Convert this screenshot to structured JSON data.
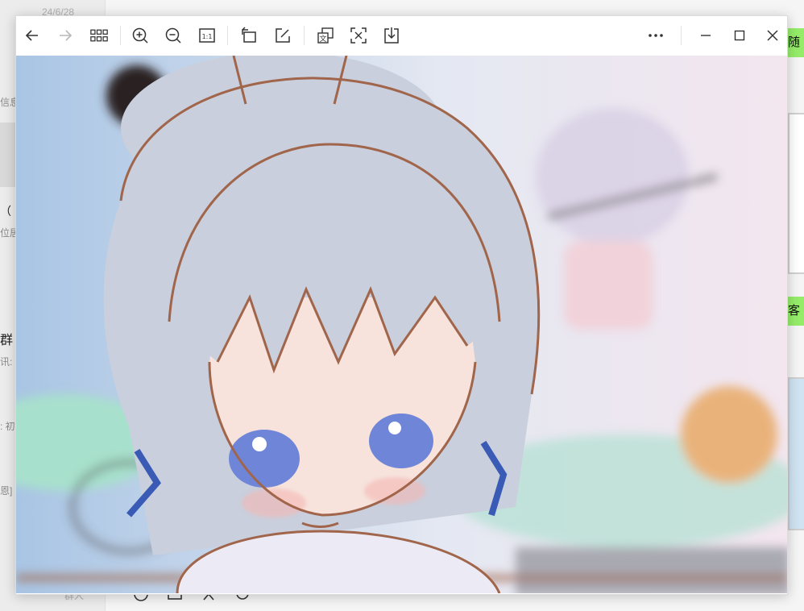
{
  "background_app": {
    "sidebar_date": "24/6/28",
    "fragments": [
      {
        "text": "信息",
        "small": true
      },
      {
        "text": "（",
        "small": false
      },
      {
        "text": "位居",
        "small": true
      },
      {
        "text": "群",
        "small": false
      },
      {
        "text": "讯:",
        "small": true
      },
      {
        "text": ": 初",
        "small": true
      },
      {
        "text": "恩]",
        "small": true
      },
      {
        "text": "群人",
        "small": true
      }
    ],
    "bubbles": [
      "随",
      "客串"
    ]
  },
  "viewer": {
    "toolbar": {
      "buttons": [
        {
          "name": "back-button",
          "icon": "arrow-left-icon",
          "label": "Back"
        },
        {
          "name": "forward-button",
          "icon": "arrow-right-icon",
          "label": "Forward"
        },
        {
          "name": "gallery-button",
          "icon": "grid-icon",
          "label": "All images"
        },
        {
          "name": "zoom-in-button",
          "icon": "zoom-in-icon",
          "label": "Zoom in"
        },
        {
          "name": "zoom-out-button",
          "icon": "zoom-out-icon",
          "label": "Zoom out"
        },
        {
          "name": "actual-size-button",
          "icon": "actual-size-icon",
          "label": "1:1"
        },
        {
          "name": "rotate-button",
          "icon": "rotate-icon",
          "label": "Rotate"
        },
        {
          "name": "edit-button",
          "icon": "edit-icon",
          "label": "Edit"
        },
        {
          "name": "translate-button",
          "icon": "translate-icon",
          "label": "Translate"
        },
        {
          "name": "extract-text-button",
          "icon": "extract-text-icon",
          "label": "Extract text"
        },
        {
          "name": "download-button",
          "icon": "download-icon",
          "label": "Save"
        },
        {
          "name": "more-button",
          "icon": "more-icon",
          "label": "More"
        },
        {
          "name": "minimize-button",
          "icon": "minimize-icon",
          "label": "Minimize"
        },
        {
          "name": "maximize-button",
          "icon": "maximize-icon",
          "label": "Maximize"
        },
        {
          "name": "close-button",
          "icon": "close-icon",
          "label": "Close"
        }
      ],
      "actual_size_glyph": "1:1",
      "translate_glyph": "文"
    },
    "image": {
      "subject": "drawn-illustration",
      "colors": {
        "line": "#a0654a",
        "hair": "#c9cfdc",
        "skin": "#f7e3dc",
        "eye": "#6f86d8",
        "ribbon": "#3a5bb5",
        "bg_left": "#a9c5e4",
        "bg_right": "#f3e6ef",
        "grass": "#a7e0cc",
        "cookie": "#e9b27a"
      }
    }
  }
}
